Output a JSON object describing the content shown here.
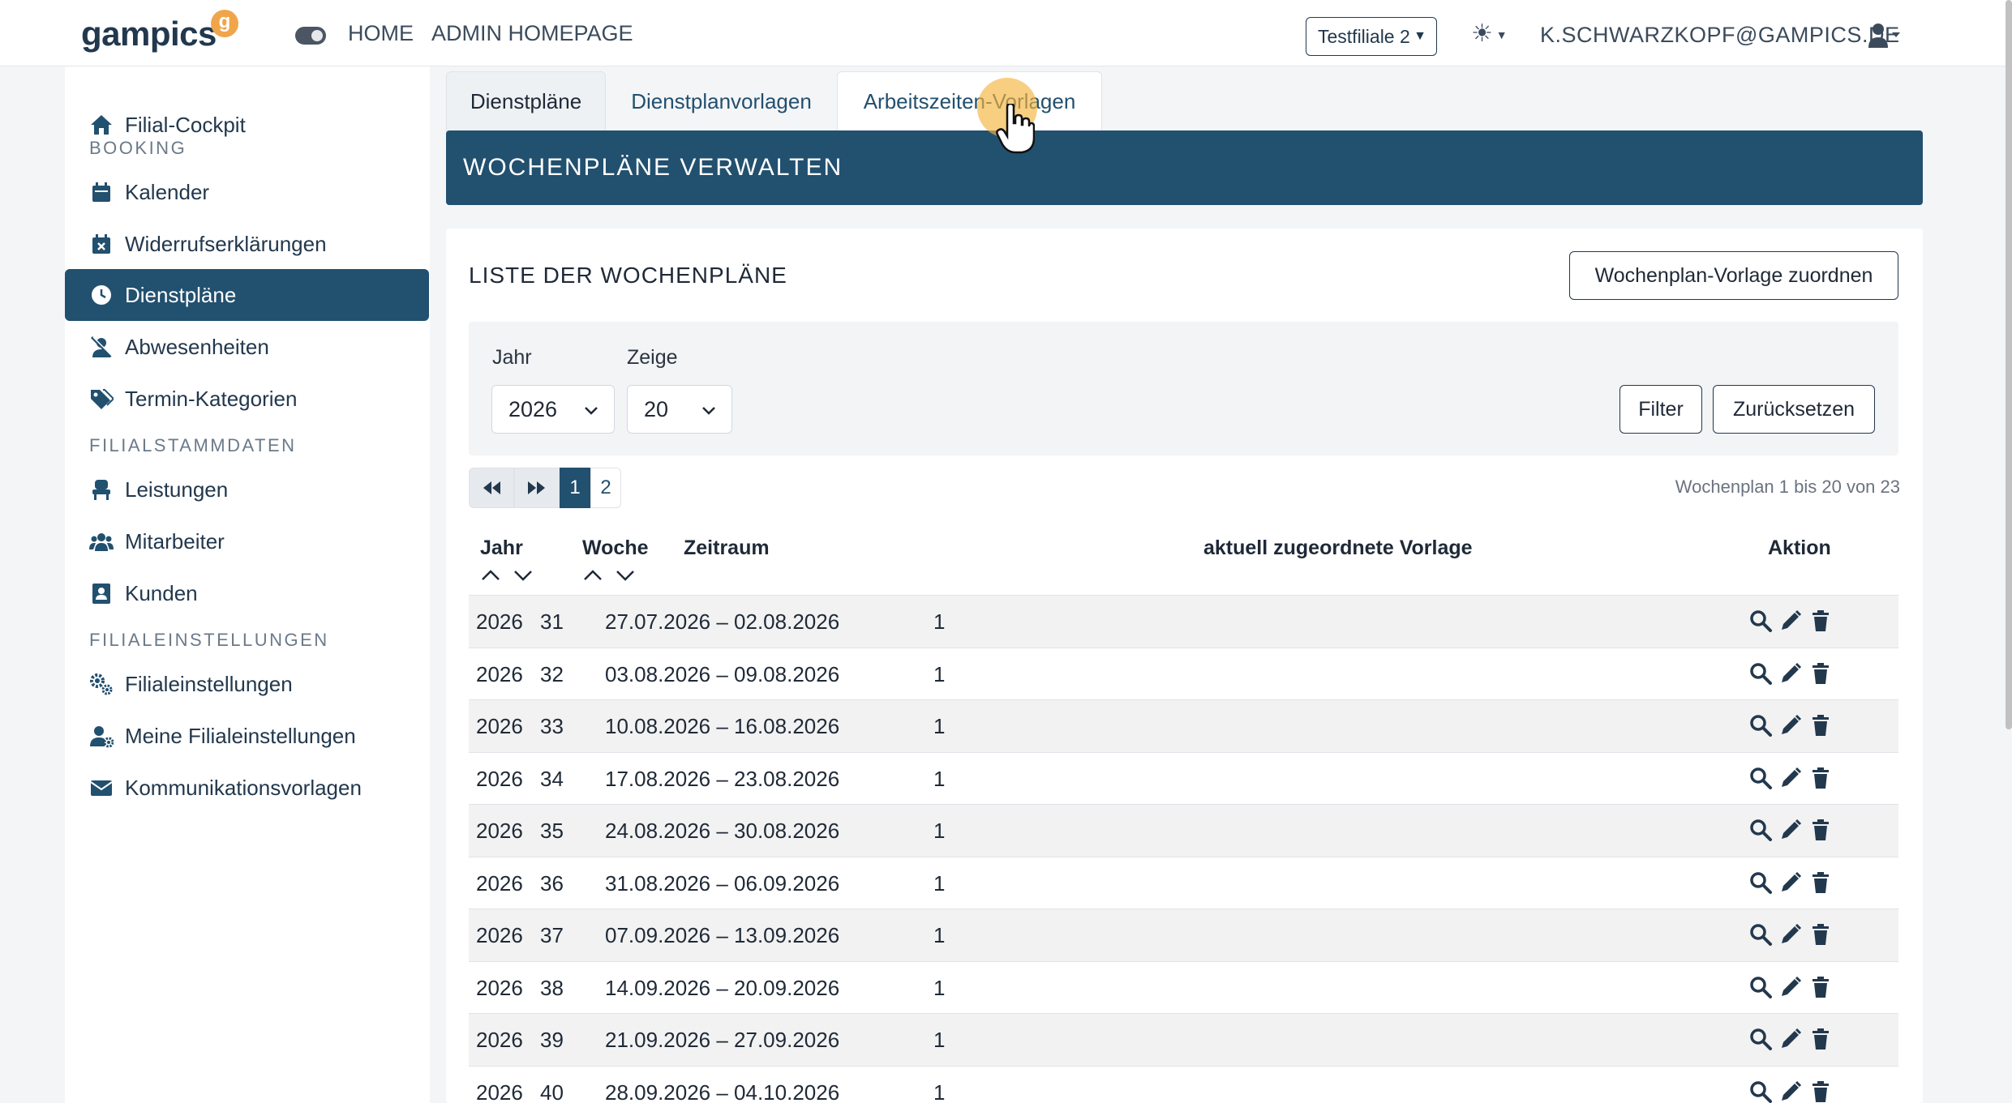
{
  "topbar": {
    "logo_text": "gampics",
    "logo_badge": "g",
    "nav_home": "HOME",
    "nav_admin": "ADMIN HOMEPAGE",
    "branch": "Testfiliale 2",
    "user_email": "K.SCHWARZKOPF@GAMPICS.DE"
  },
  "sidebar": {
    "items": [
      {
        "label": "Filial-Cockpit",
        "icon": "home-icon"
      },
      {
        "label": "Kalender",
        "icon": "calendar-icon"
      },
      {
        "label": "Widerrufserklärungen",
        "icon": "calendar-x-icon"
      },
      {
        "label": "Dienstpläne",
        "icon": "clock-icon",
        "active": true
      },
      {
        "label": "Abwesenheiten",
        "icon": "user-slash-icon"
      },
      {
        "label": "Termin-Kategorien",
        "icon": "tags-icon"
      },
      {
        "label": "Leistungen",
        "icon": "chair-icon"
      },
      {
        "label": "Mitarbeiter",
        "icon": "users-icon"
      },
      {
        "label": "Kunden",
        "icon": "contact-card-icon"
      },
      {
        "label": "Filialeinstellungen",
        "icon": "gears-icon"
      },
      {
        "label": "Meine Filialeinstellungen",
        "icon": "user-gear-icon"
      },
      {
        "label": "Kommunikationsvorlagen",
        "icon": "envelope-icon"
      }
    ],
    "headings": [
      "BOOKING",
      "FILIALSTAMMDATEN",
      "FILIALEINSTELLUNGEN"
    ]
  },
  "tabs": [
    "Dienstpläne",
    "Dienstplanvorlagen",
    "Arbeitszeiten-Vorlagen"
  ],
  "banner_title": "WOCHENPLÄNE VERWALTEN",
  "card": {
    "title": "LISTE DER WOCHENPLÄNE",
    "assign_button": "Wochenplan-Vorlage zuordnen",
    "filter": {
      "year_label": "Jahr",
      "year_value": "2026",
      "show_label": "Zeige",
      "show_value": "20",
      "filter_button": "Filter",
      "reset_button": "Zurücksetzen"
    },
    "pager": {
      "pages": [
        "1",
        "2"
      ],
      "current": "1"
    },
    "range_info": "Wochenplan 1 bis 20 von 23",
    "columns": [
      "Jahr",
      "Woche",
      "Zeitraum",
      "aktuell zugeordnete Vorlage",
      "Aktion"
    ],
    "rows": [
      [
        "2026",
        "31",
        "27.07.2026 – 02.08.2026",
        "1"
      ],
      [
        "2026",
        "32",
        "03.08.2026 – 09.08.2026",
        "1"
      ],
      [
        "2026",
        "33",
        "10.08.2026 – 16.08.2026",
        "1"
      ],
      [
        "2026",
        "34",
        "17.08.2026 – 23.08.2026",
        "1"
      ],
      [
        "2026",
        "35",
        "24.08.2026 – 30.08.2026",
        "1"
      ],
      [
        "2026",
        "36",
        "31.08.2026 – 06.09.2026",
        "1"
      ],
      [
        "2026",
        "37",
        "07.09.2026 – 13.09.2026",
        "1"
      ],
      [
        "2026",
        "38",
        "14.09.2026 – 20.09.2026",
        "1"
      ],
      [
        "2026",
        "39",
        "21.09.2026 – 27.09.2026",
        "1"
      ],
      [
        "2026",
        "40",
        "28.09.2026 – 04.10.2026",
        "1"
      ]
    ]
  },
  "colors": {
    "primary": "#22506f",
    "dark": "#22384d",
    "accent": "#f0a54a",
    "row_alt": "#f2f2f2"
  }
}
